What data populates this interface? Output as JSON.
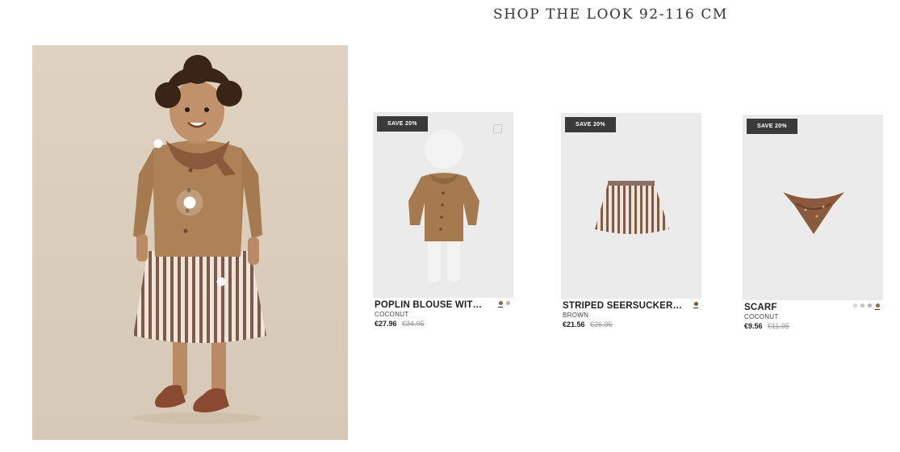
{
  "section": {
    "title": "SHOP THE LOOK 92-116 CM"
  },
  "products": [
    {
      "badge": "SAVE 20%",
      "name": "POPLIN BLOUSE WITH SC...",
      "color": "COCONUT",
      "price": "€27.96",
      "old_price": "€34.95",
      "swatch_colors": [
        "#8a6a4a",
        "#bfb2a4"
      ]
    },
    {
      "badge": "SAVE 20%",
      "name": "STRIPED SEERSUCKER SKIRT",
      "color": "BROWN",
      "price": "€21.56",
      "old_price": "€26.95",
      "swatch_colors": [
        "#6d5440"
      ]
    },
    {
      "badge": "SAVE 20%",
      "name": "SCARF",
      "color": "COCONUT",
      "price": "€9.56",
      "old_price": "€11.95",
      "swatch_colors": [
        "#d8d8d8",
        "#c9c0b7",
        "#b9ada3",
        "#8a6a4a"
      ]
    }
  ],
  "colors": {
    "background": "#ffffff",
    "card_bg": "#ebebeb",
    "badge_bg": "#3a3a3a",
    "hero_bg": "#dccfbd"
  }
}
